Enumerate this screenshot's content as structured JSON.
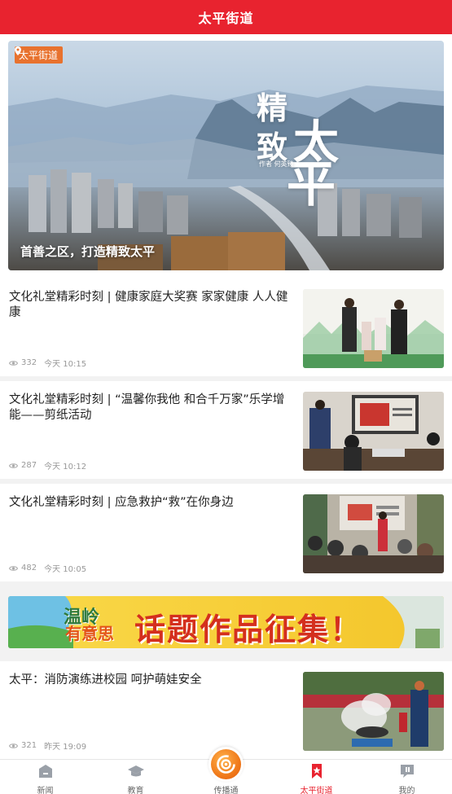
{
  "header": {
    "title": "太平街道"
  },
  "hero": {
    "tag": "太平街道",
    "caption": "首善之区，打造精致太平",
    "calligraphy": [
      "精",
      "致",
      "太",
      "平"
    ],
    "credit": "作者 何英臻"
  },
  "articles": [
    {
      "title": "文化礼堂精彩时刻 | 健康家庭大奖赛 家家健康 人人健康",
      "views": "332",
      "time": "今天 10:15"
    },
    {
      "title": "文化礼堂精彩时刻 | “温馨你我他 和合千万家”乐学增能——剪纸活动",
      "views": "287",
      "time": "今天 10:12"
    },
    {
      "title": "文化礼堂精彩时刻 | 应急救护“救”在你身边",
      "views": "482",
      "time": "今天 10:05"
    },
    {
      "title": "太平：消防演练进校园 呵护萌娃安全",
      "views": "321",
      "time": "昨天 19:09"
    }
  ],
  "banner": {
    "logo_line1": "温岭",
    "logo_line2": "有意思",
    "text": "话题作品征集！"
  },
  "tabs": [
    {
      "label": "新闻",
      "icon": "home-icon"
    },
    {
      "label": "教育",
      "icon": "graduation-cap-icon"
    },
    {
      "label": "传播通",
      "icon": "broadcast-icon"
    },
    {
      "label": "太平街道",
      "icon": "bookmark-star-icon"
    },
    {
      "label": "我的",
      "icon": "chat-bubble-icon"
    }
  ],
  "colors": {
    "brand_red": "#e8232f",
    "tag_orange": "#e8722e",
    "meta_gray": "#999999"
  }
}
